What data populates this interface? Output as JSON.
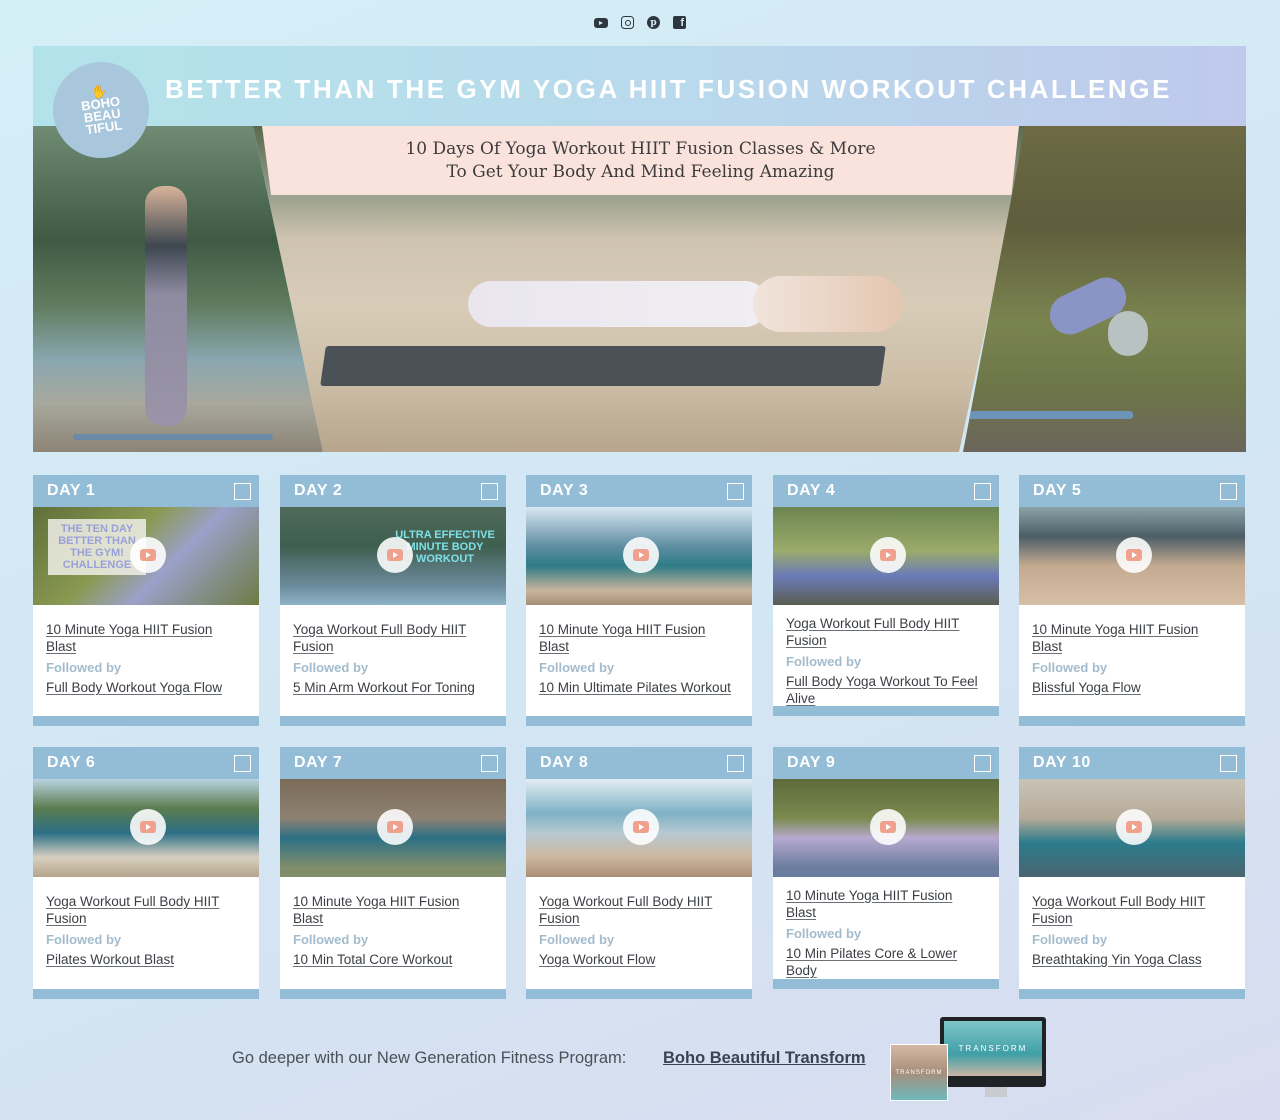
{
  "social": {
    "icons": [
      "youtube-icon",
      "instagram-icon",
      "pinterest-icon",
      "facebook-icon"
    ]
  },
  "hero": {
    "title": "BETTER THAN THE GYM YOGA HIIT FUSION WORKOUT CHALLENGE",
    "subtitle_line1": "10 Days Of Yoga Workout HIIT Fusion Classes & More",
    "subtitle_line2": "To Get Your Body And Mind Feeling Amazing",
    "logo_text": "BOHO BEAUTIFUL"
  },
  "colors": {
    "card_header": "#93bcd6",
    "followed_by": "#a3bccd",
    "play_button": "#f0a18e",
    "subtitle_band": "#fae2dd"
  },
  "followed_label": "Followed by",
  "days": [
    {
      "label": "DAY 1",
      "main": "10 Minute Yoga HIIT Fusion Blast",
      "follow": "Full Body Workout Yoga Flow",
      "thumb_text": "THE TEN DAY BETTER THAN THE GYM! CHALLENGE"
    },
    {
      "label": "DAY 2",
      "main": "Yoga Workout Full Body HIIT Fusion",
      "follow": "5 Min Arm Workout For Toning",
      "thumb_text": "ULTRA EFFECTIVE MINUTE BODY WORKOUT"
    },
    {
      "label": "DAY 3",
      "main": "10 Minute Yoga HIIT Fusion Blast",
      "follow": "10 Min Ultimate Pilates Workout"
    },
    {
      "label": "DAY 4",
      "main": "Yoga Workout Full Body HIIT Fusion",
      "follow": "Full Body Yoga Workout To Feel Alive"
    },
    {
      "label": "DAY 5",
      "main": "10 Minute Yoga HIIT Fusion Blast",
      "follow": "Blissful Yoga Flow"
    },
    {
      "label": "DAY 6",
      "main": "Yoga Workout Full Body HIIT Fusion",
      "follow": "Pilates Workout Blast"
    },
    {
      "label": "DAY 7",
      "main": "10 Minute Yoga HIIT Fusion Blast",
      "follow": "10 Min Total Core Workout"
    },
    {
      "label": "DAY 8",
      "main": "Yoga Workout Full Body HIIT Fusion",
      "follow": "Yoga Workout Flow"
    },
    {
      "label": "DAY 9",
      "main": "10 Minute Yoga HIIT Fusion Blast",
      "follow": "10 Min Pilates Core & Lower Body"
    },
    {
      "label": "DAY 10",
      "main": "Yoga Workout Full Body HIIT Fusion",
      "follow": "Breathtaking Yin Yoga Class"
    }
  ],
  "footer": {
    "text": "Go deeper with our New Generation Fitness Program:",
    "link": "Boho Beautiful Transform",
    "promo_label": "TRANSFORM"
  }
}
